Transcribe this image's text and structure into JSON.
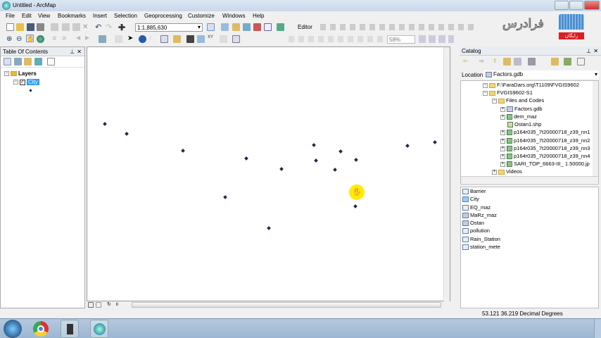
{
  "window": {
    "title": "Untitled - ArcMap"
  },
  "menu": [
    "File",
    "Edit",
    "View",
    "Bookmarks",
    "Insert",
    "Selection",
    "Geoprocessing",
    "Customize",
    "Windows",
    "Help"
  ],
  "toolbar": {
    "scale": "1:1,885,630",
    "editor": "Editor",
    "zoom_percent": "58%"
  },
  "logo": {
    "text": "فرادرس",
    "badge": "رایگان"
  },
  "toc": {
    "title": "Table Of Contents",
    "root": "Layers",
    "layer": "City"
  },
  "catalog": {
    "title": "Catalog",
    "location_label": "Location:",
    "location_value": "Factors.gdb",
    "tree": [
      "F:\\FaraDars.org\\T1109\\FVGIS9602",
      "FVGIS9602-S1",
      "Files and Codes",
      "Factors.gdb",
      "dem_maz",
      "Ostan1.shp",
      "p164r035_7t20000718_z39_nn1",
      "p164r035_7t20000718_z39_nn2",
      "p164r035_7t20000718_z39_nn3",
      "p164r035_7t20000718_z39_nn4",
      "SARI_TOP_6663-III_ 1.50000.jp",
      "Videos"
    ],
    "contents": [
      "Barrier",
      "City",
      "EQ_maz",
      "MaRz_maz",
      "Ostan",
      "pollution",
      "Rain_Station",
      "station_mete"
    ]
  },
  "status": {
    "coords": "53.121  36.219 Decimal Degrees"
  }
}
